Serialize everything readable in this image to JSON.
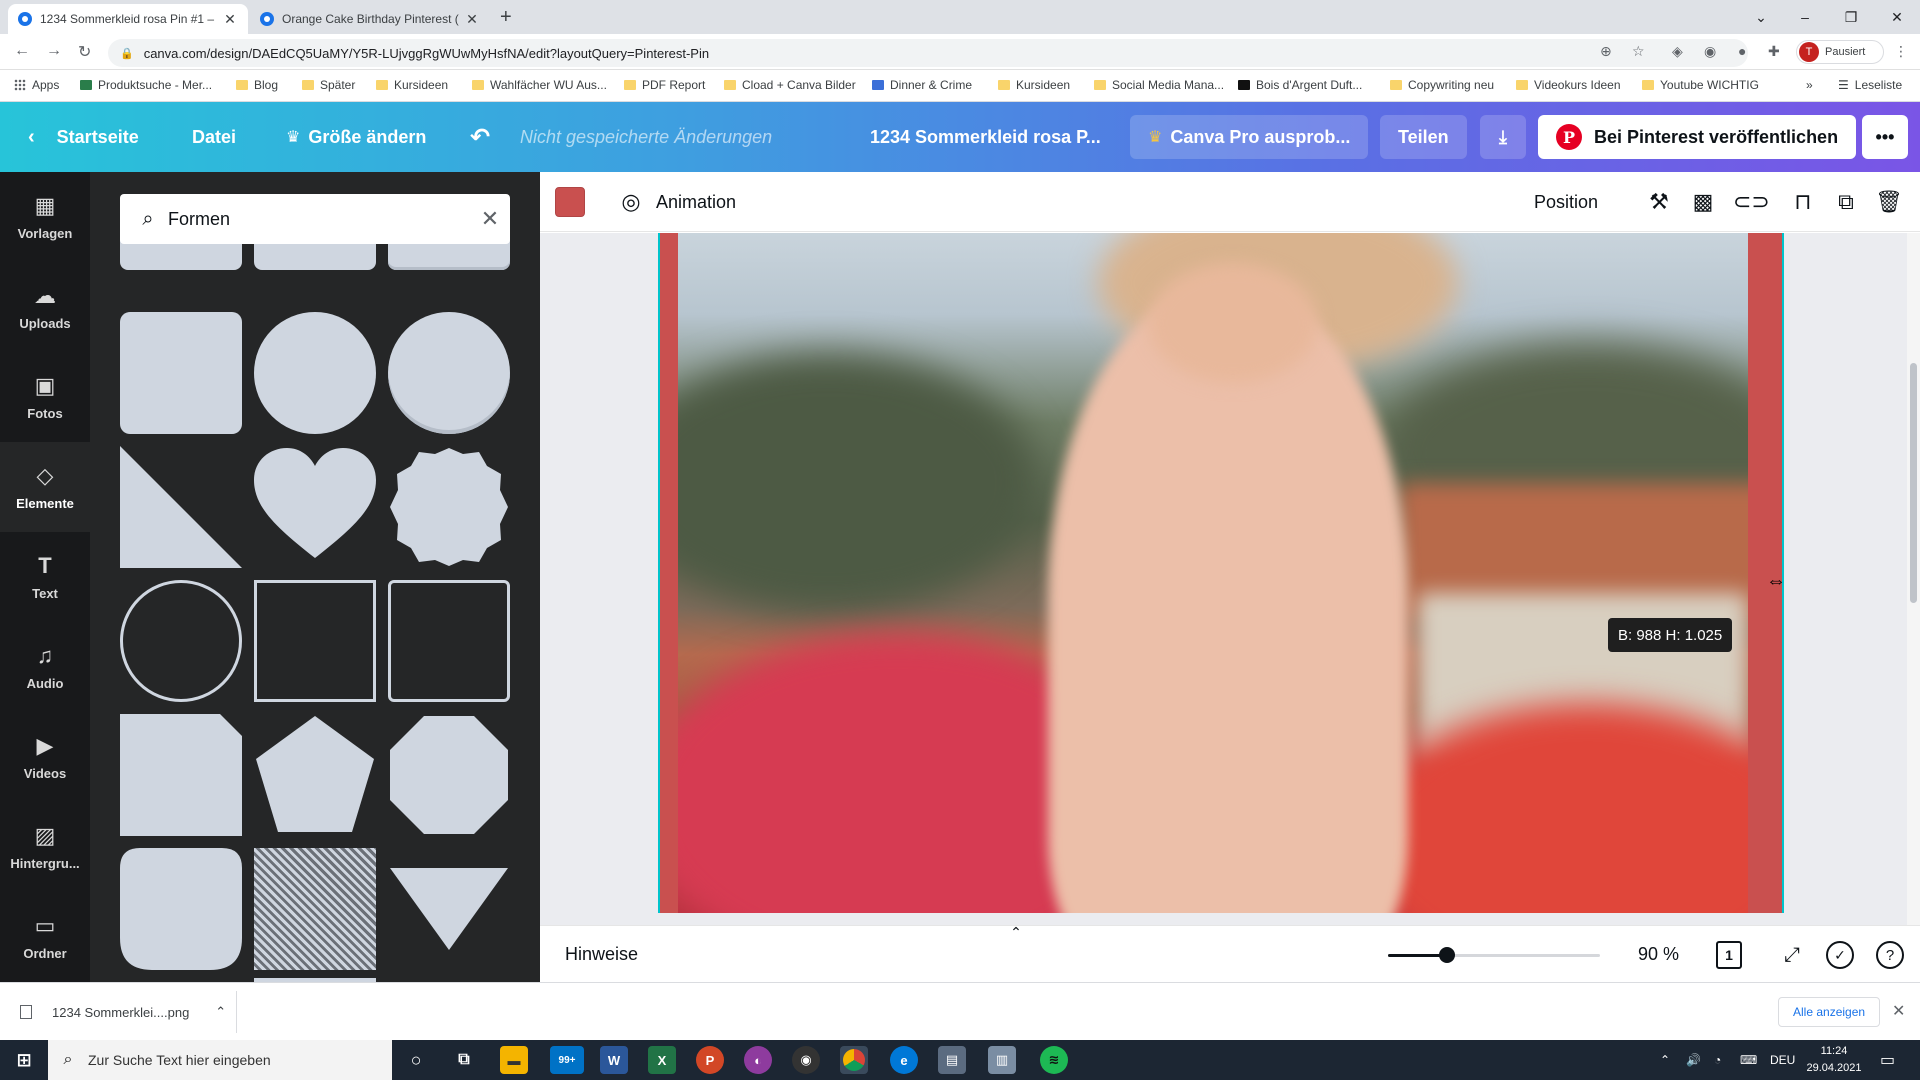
{
  "browser": {
    "tabs": [
      {
        "title": "1234 Sommerkleid rosa Pin #1 –",
        "active": true
      },
      {
        "title": "Orange Cake Birthday Pinterest (",
        "active": false
      }
    ],
    "new_tab": "+",
    "window_controls": {
      "minimize": "–",
      "maximize": "❐",
      "close": "✕"
    },
    "url": "canva.com/design/DAEdCQ5UaMY/Y5R-LUjvggRgWUwMyHsfNA/edit?layoutQuery=Pinterest-Pin",
    "profile_initial": "T",
    "profile_status": "Pausiert",
    "bookmarks": [
      "Apps",
      "Produktsuche - Mer...",
      "Blog",
      "Später",
      "Kursideen",
      "Wahlfächer WU Aus...",
      "PDF Report",
      "Cload + Canva Bilder",
      "Dinner & Crime",
      "Kursideen",
      "Social Media Mana...",
      "Bois d'Argent Duft...",
      "Copywriting neu",
      "Videokurs Ideen",
      "Youtube WICHTIG"
    ],
    "bookmarks_more": "»",
    "reading_list": "Leseliste"
  },
  "canva_header": {
    "back_label": "Startseite",
    "file_label": "Datei",
    "resize_label": "Größe ändern",
    "unsaved_label": "Nicht gespeicherte Änderungen",
    "design_title": "1234 Sommerkleid rosa P...",
    "pro_label": "Canva Pro ausprob...",
    "share_label": "Teilen",
    "publish_label": "Bei Pinterest veröffentlichen",
    "more_label": "•••"
  },
  "sidebar": {
    "items": [
      {
        "label": "Vorlagen",
        "icon": "templates-icon"
      },
      {
        "label": "Uploads",
        "icon": "upload-icon"
      },
      {
        "label": "Fotos",
        "icon": "photos-icon"
      },
      {
        "label": "Elemente",
        "icon": "elements-icon"
      },
      {
        "label": "Text",
        "icon": "text-icon"
      },
      {
        "label": "Audio",
        "icon": "audio-icon"
      },
      {
        "label": "Videos",
        "icon": "videos-icon"
      },
      {
        "label": "Hintergru...",
        "icon": "background-icon"
      },
      {
        "label": "Ordner",
        "icon": "folder-icon"
      }
    ],
    "active_index": 3
  },
  "panel": {
    "search_value": "Formen"
  },
  "toolbar": {
    "color_swatch": "#c9504f",
    "animation_label": "Animation",
    "position_label": "Position"
  },
  "canvas": {
    "dimensions_label": "B: 988 H: 1.025",
    "frame_color": "#c9504f",
    "selection_color": "#00c4cc"
  },
  "footer": {
    "notes_label": "Hinweise",
    "zoom_value": "90 %",
    "zoom_fraction": 0.28,
    "page_count": "1"
  },
  "downloads": {
    "file_name": "1234 Sommerklei....png",
    "show_all": "Alle anzeigen"
  },
  "taskbar": {
    "search_placeholder": "Zur Suche Text hier eingeben",
    "mail_badge": "99+",
    "language": "DEU",
    "time": "11:24",
    "date": "29.04.2021"
  }
}
